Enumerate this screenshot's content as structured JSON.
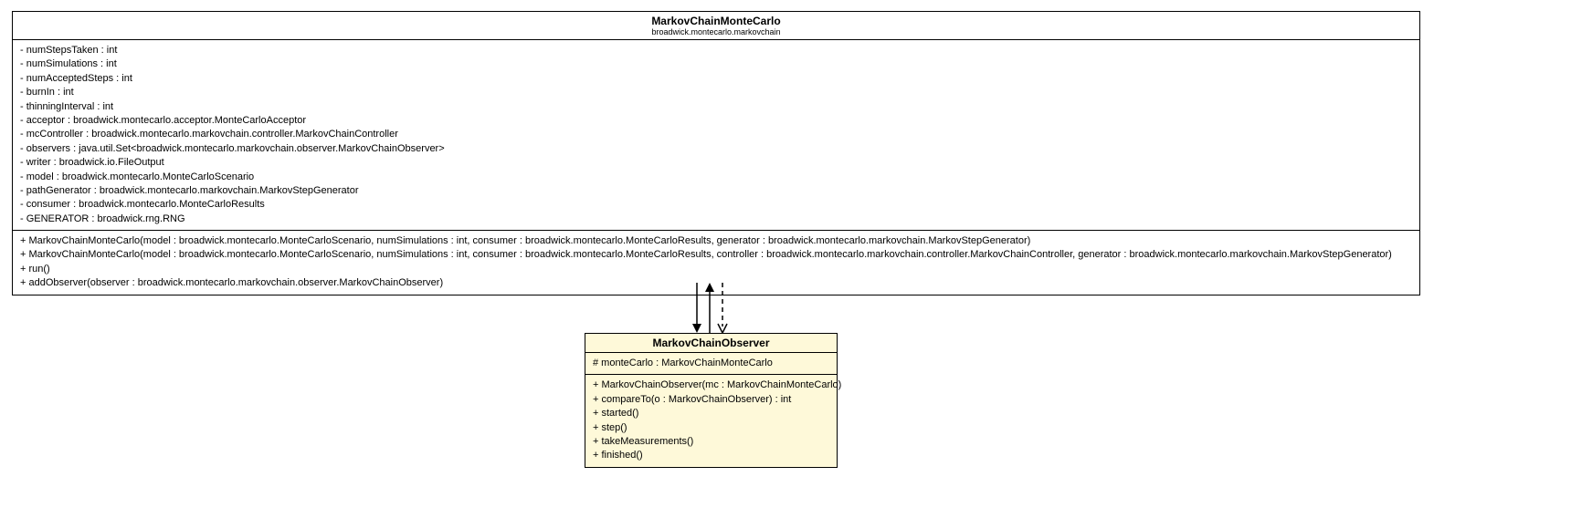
{
  "class1": {
    "name": "MarkovChainMonteCarlo",
    "package": "broadwick.montecarlo.markovchain",
    "attributes": [
      "- numStepsTaken : int",
      "- numSimulations : int",
      "- numAcceptedSteps : int",
      "- burnIn : int",
      "- thinningInterval : int",
      "- acceptor : broadwick.montecarlo.acceptor.MonteCarloAcceptor",
      "- mcController : broadwick.montecarlo.markovchain.controller.MarkovChainController",
      "- observers : java.util.Set<broadwick.montecarlo.markovchain.observer.MarkovChainObserver>",
      "- writer : broadwick.io.FileOutput",
      "- model : broadwick.montecarlo.MonteCarloScenario",
      "- pathGenerator : broadwick.montecarlo.markovchain.MarkovStepGenerator",
      "- consumer : broadwick.montecarlo.MonteCarloResults",
      "- GENERATOR : broadwick.rng.RNG"
    ],
    "methods": [
      "+ MarkovChainMonteCarlo(model : broadwick.montecarlo.MonteCarloScenario, numSimulations : int, consumer : broadwick.montecarlo.MonteCarloResults, generator : broadwick.montecarlo.markovchain.MarkovStepGenerator)",
      "+ MarkovChainMonteCarlo(model : broadwick.montecarlo.MonteCarloScenario, numSimulations : int, consumer : broadwick.montecarlo.MonteCarloResults, controller : broadwick.montecarlo.markovchain.controller.MarkovChainController, generator : broadwick.montecarlo.markovchain.MarkovStepGenerator)",
      "+ run()",
      "+ addObserver(observer : broadwick.montecarlo.markovchain.observer.MarkovChainObserver)"
    ]
  },
  "class2": {
    "name": "MarkovChainObserver",
    "attributes": [
      "# monteCarlo : MarkovChainMonteCarlo"
    ],
    "methods": [
      "+ MarkovChainObserver(mc : MarkovChainMonteCarlo)",
      "+ compareTo(o : MarkovChainObserver) : int",
      "+ started()",
      "+ step()",
      "+ takeMeasurements()",
      "+ finished()"
    ]
  }
}
